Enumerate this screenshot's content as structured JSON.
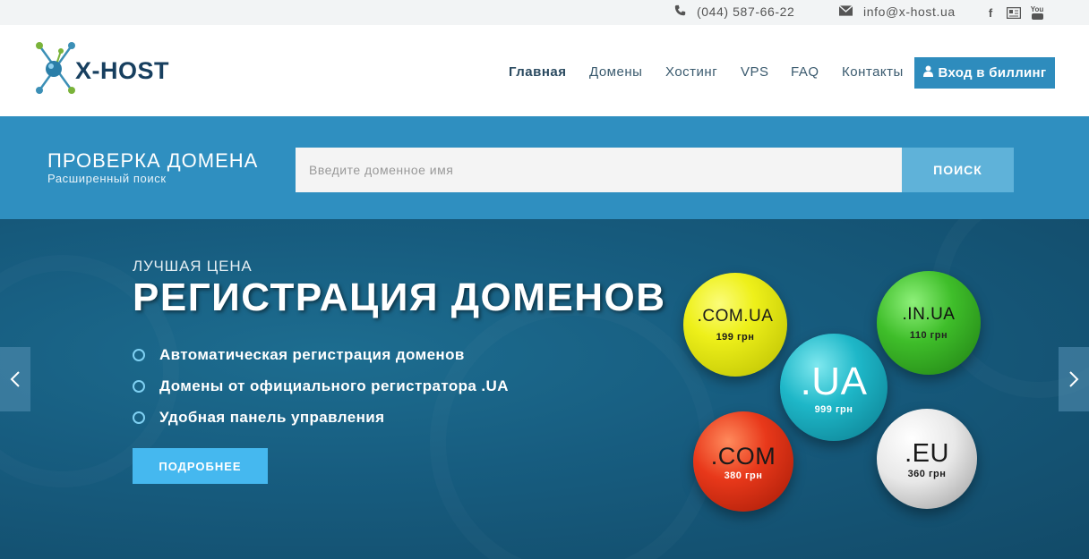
{
  "topbar": {
    "phone": "(044) 587-66-22",
    "email": "info@x-host.ua",
    "social": [
      "f",
      "▤",
      "You"
    ]
  },
  "header": {
    "logo_text": "X-HOST",
    "nav": [
      "Главная",
      "Домены",
      "Хостинг",
      "VPS",
      "FAQ",
      "Контакты"
    ],
    "active_nav": "Главная",
    "billing_button": "Вход в биллинг"
  },
  "domain_check": {
    "title": "ПРОВЕРКА ДОМЕНА",
    "subtitle": "Расширенный поиск",
    "placeholder": "Введите доменное имя",
    "button": "ПОИСК"
  },
  "hero": {
    "label": "ЛУЧШАЯ ЦЕНА",
    "title": "РЕГИСТРАЦИЯ ДОМЕНОВ",
    "features": [
      "Автоматическая регистрация доменов",
      "Домены от официального регистратора .UA",
      "Удобная панель управления"
    ],
    "more_button": "ПОДРОБНЕЕ",
    "domains": [
      {
        "zone": ".COM.UA",
        "price": "199 грн",
        "color": "#eef01a"
      },
      {
        "zone": ".IN.UA",
        "price": "110 грн",
        "color": "#3fbe2a"
      },
      {
        "zone": ".UA",
        "price": "999 грн",
        "color": "#1eb7c8"
      },
      {
        "zone": ".COM",
        "price": "380 грн",
        "color": "#e8381a"
      },
      {
        "zone": ".EU",
        "price": "360 грн",
        "color": "#e8e8e8"
      }
    ]
  },
  "colors": {
    "accent": "#2e8cbd",
    "band": "#2f8fc0",
    "search_button": "#5fb2d9",
    "more_button": "#45b8ef",
    "hero_bg": "#175d80"
  }
}
